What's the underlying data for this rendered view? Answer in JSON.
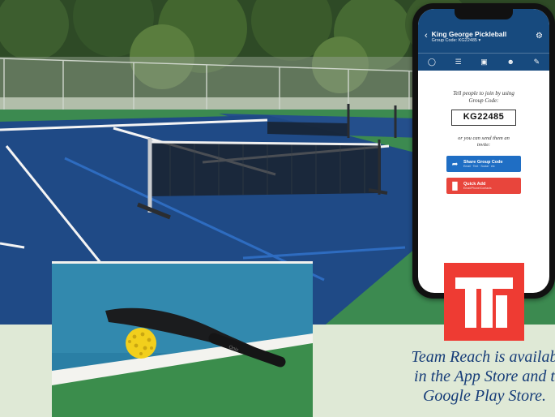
{
  "phone": {
    "group_name": "King George Pickleball",
    "group_code_line": "Group Code: KG22485 ▾",
    "tabs": [
      "chat-icon",
      "list-icon",
      "photo-icon",
      "members-icon",
      "edit-icon"
    ],
    "prompt": "Tell people to join by using Group Code:",
    "group_code": "KG22485",
    "or_send": "or you can send them an invite:",
    "share_button": {
      "label": "Share Group Code",
      "sublabel": "Email · Text · Social · etc"
    },
    "quick_add_button": {
      "label": "Quick Add",
      "sublabel": "Email/Phone/Contacts"
    }
  },
  "caption": {
    "line1": "Team Reach is availab",
    "line2": "in the App Store and t",
    "line3": "Google Play Store."
  },
  "colors": {
    "court_blue": "#1f4a86",
    "court_green": "#3c8a50",
    "app_header": "#174a7e",
    "logo_red": "#ee3b33",
    "caption_text": "#163c78",
    "ball_yellow": "#f2cf1c"
  }
}
